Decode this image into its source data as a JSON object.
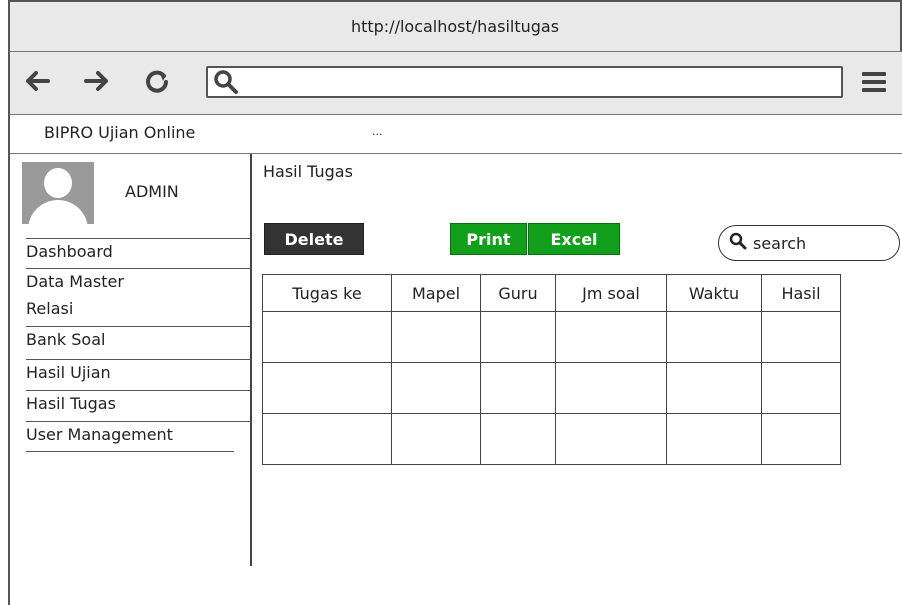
{
  "browser": {
    "url": "http://localhost/hasiltugas"
  },
  "app": {
    "name": "BIPRO Ujian Online",
    "menu_dots": "..."
  },
  "sidebar": {
    "user": "ADMIN",
    "items": [
      {
        "label": "Dashboard"
      },
      {
        "label": "Data Master"
      },
      {
        "label": "Relasi"
      },
      {
        "label": "Bank Soal"
      },
      {
        "label": "Hasil Ujian"
      },
      {
        "label": "Hasil Tugas"
      },
      {
        "label": "User Management"
      }
    ]
  },
  "main": {
    "title": "Hasil Tugas",
    "buttons": {
      "delete": "Delete",
      "print": "Print",
      "excel": "Excel"
    },
    "search_placeholder": "search",
    "table": {
      "headers": [
        "Tugas ke",
        "Mapel",
        "Guru",
        "Jm soal",
        "Waktu",
        "Hasil"
      ],
      "rows": [
        [
          "",
          "",
          "",
          "",
          "",
          ""
        ],
        [
          "",
          "",
          "",
          "",
          "",
          ""
        ],
        [
          "",
          "",
          "",
          "",
          "",
          ""
        ]
      ]
    }
  },
  "colors": {
    "print_excel": "#12a01c",
    "delete": "#333333",
    "chrome": "#e9e9e9"
  },
  "icons": [
    "back-arrow-icon",
    "forward-arrow-icon",
    "refresh-icon",
    "search-icon",
    "hamburger-menu-icon",
    "user-avatar-icon"
  ]
}
